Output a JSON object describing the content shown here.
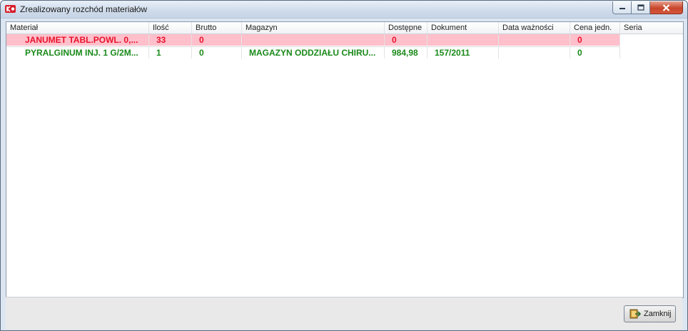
{
  "window": {
    "title": "Zrealizowany rozchód materiałów",
    "icon": "app-logo-icon",
    "controls": [
      "minimize-icon",
      "maximize-icon",
      "close-icon"
    ]
  },
  "table": {
    "columns": [
      "Materiał",
      "Ilość",
      "Brutto",
      "Magazyn",
      "Dostępne",
      "Dokument",
      "Data ważności",
      "Cena jedn.",
      "Seria"
    ],
    "rows": [
      {
        "status": "red",
        "material": "JANUMET TABL.POWL. 0,...",
        "ilosc": "33",
        "brutto": "0",
        "magazyn": "",
        "dostepne": "0",
        "dokument": "",
        "data_waznosci": "",
        "cena": "0",
        "seria": ""
      },
      {
        "status": "green",
        "material": "PYRALGINUM INJ. 1 G/2M...",
        "ilosc": "1",
        "brutto": "0",
        "magazyn": "MAGAZYN ODDZIAŁU CHIRU...",
        "dostepne": "984,98",
        "dokument": "157/2011",
        "data_waznosci": "",
        "cena": "0",
        "seria": ""
      }
    ]
  },
  "footer": {
    "close_button_label": "Zamknij",
    "close_button_icon": "exit-door-icon"
  },
  "colors": {
    "row_red_bg": "#ffc0cb",
    "row_red_text": "#e8122c",
    "row_green_text": "#1a8a1a"
  }
}
